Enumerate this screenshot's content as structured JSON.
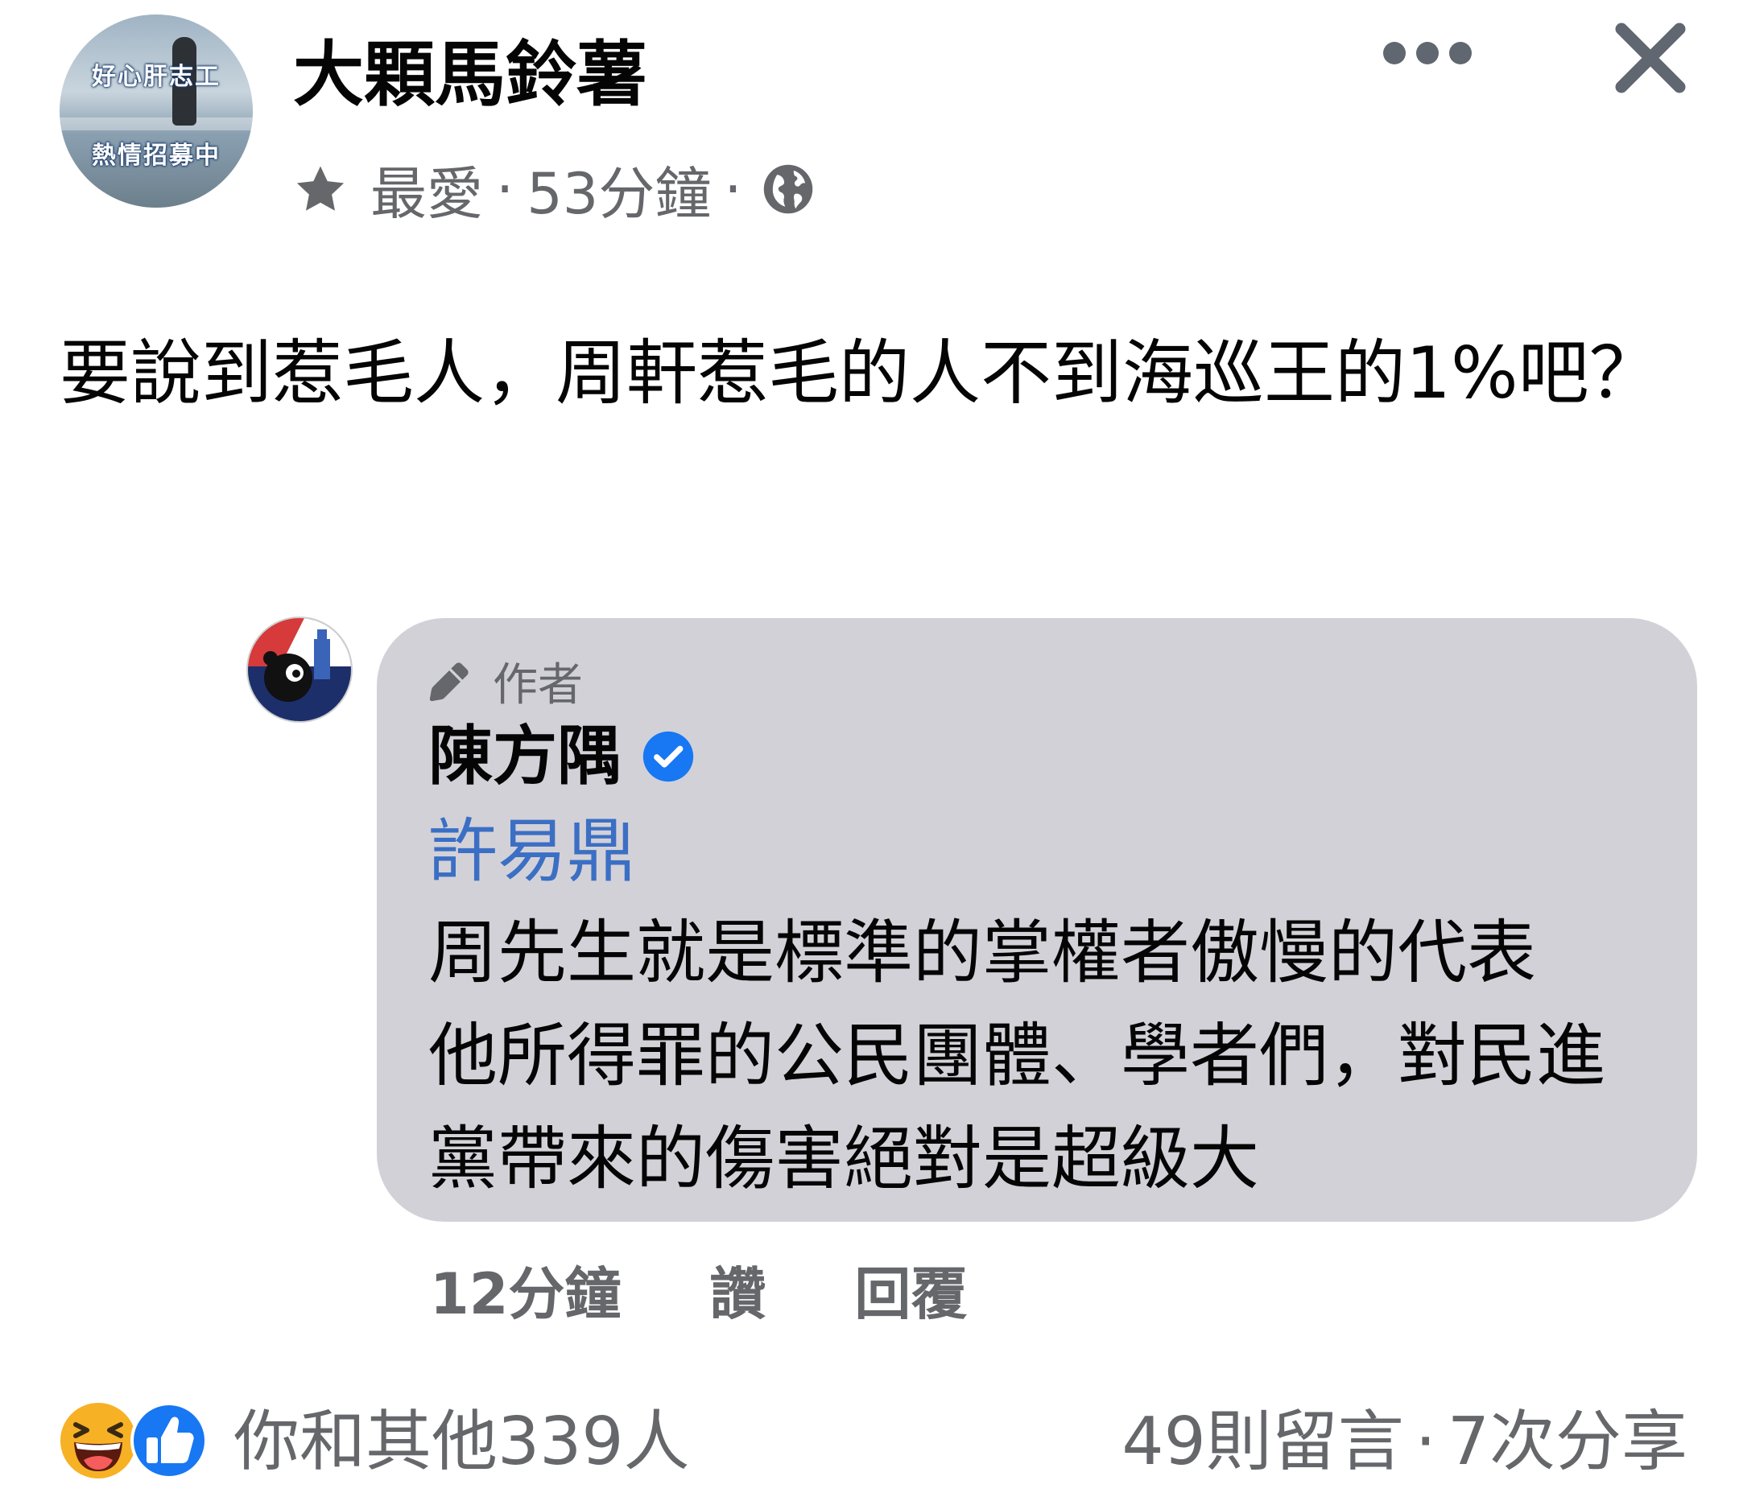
{
  "post": {
    "page_name": "大顆馬鈴薯",
    "avatar_text_top": "好心肝志工",
    "avatar_text_bottom": "熱情招募中",
    "audience": "最愛",
    "dot": "·",
    "time": "53分鐘",
    "text": "要說到惹毛人，周軒惹毛的人不到海巡王的1%吧？"
  },
  "comment": {
    "badge": "作者",
    "author": "陳方隅",
    "mention": "許易鼎",
    "lines": [
      "周先生就是標準的掌權者傲慢的代表",
      "他所得罪的公民團體、學者們，對民進",
      "黨帶來的傷害絕對是超級大"
    ],
    "time": "12分鐘",
    "like_label": "讚",
    "reply_label": "回覆"
  },
  "footer": {
    "reactions_text": "你和其他339人",
    "comments_text": "49則留言",
    "dot": "·",
    "shares_text": "7次分享"
  },
  "icons": {
    "star": "star-icon",
    "globe": "globe-icon",
    "more": "more-icon",
    "close": "close-icon",
    "pencil": "pencil-icon",
    "verified": "verified-icon",
    "haha": "haha-icon",
    "like": "like-reaction-icon"
  },
  "colors": {
    "bubble": "#d3d1d8",
    "mention": "#3b6fc4",
    "verified": "#1877f2",
    "secondary_text": "#65676b"
  }
}
